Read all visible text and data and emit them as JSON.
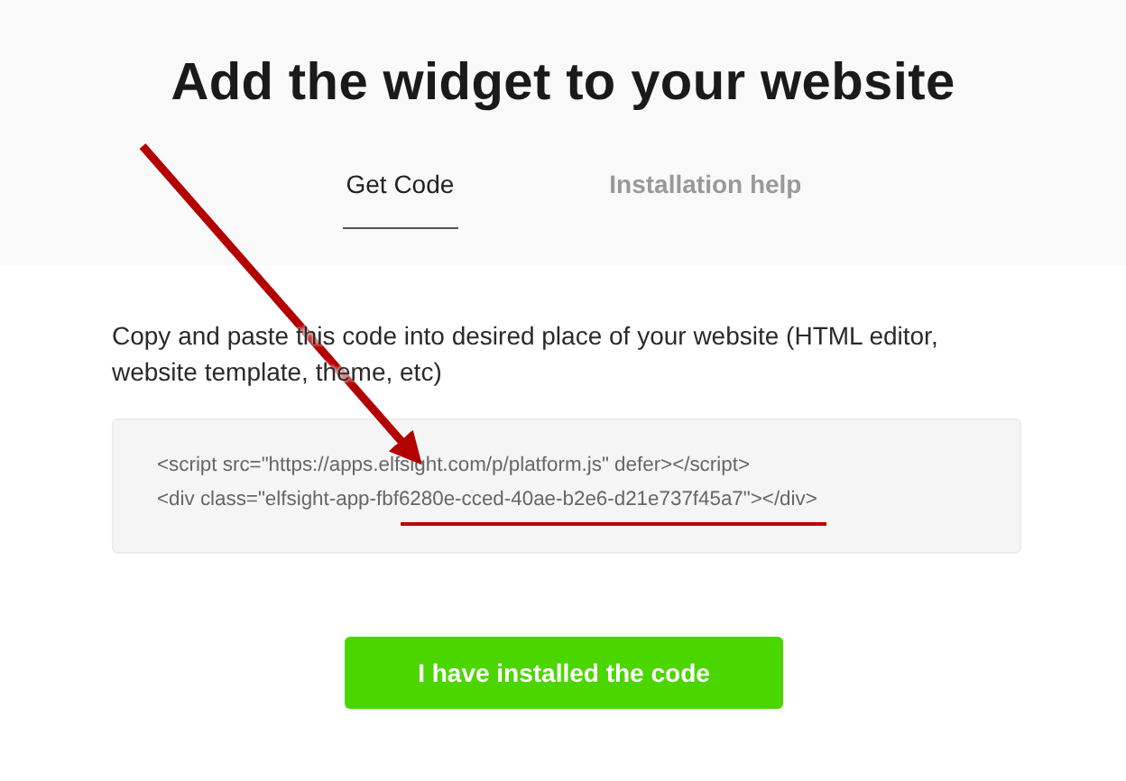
{
  "title": "Add the widget to your website",
  "tabs": [
    {
      "label": "Get Code",
      "selected": true
    },
    {
      "label": "Installation help",
      "selected": false
    }
  ],
  "instructions": "Copy and paste this code into desired place of your website (HTML editor, website template, theme, etc)",
  "code_lines": [
    "<script src=\"https://apps.elfsight.com/p/platform.js\" defer></script>",
    "<div class=\"elfsight-app-fbf6280e-cced-40ae-b2e6-d21e737f45a7\"></div>"
  ],
  "button": "I have installed the code"
}
